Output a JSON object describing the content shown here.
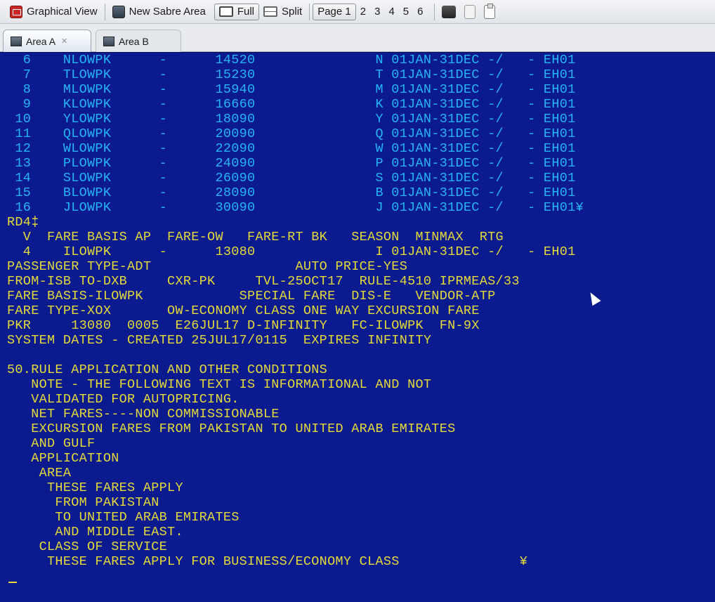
{
  "toolbar": {
    "graphical_view": "Graphical View",
    "new_sabre_area": "New Sabre Area",
    "full": "Full",
    "split": "Split",
    "page_label": "Page 1",
    "pages": [
      "2",
      "3",
      "4",
      "5",
      "6"
    ]
  },
  "tabs": [
    {
      "label": "Area A",
      "active": true
    },
    {
      "label": "Area B",
      "active": false
    }
  ],
  "terminal": {
    "background_color": "#0b1a8f",
    "text_color": "#e4da3a",
    "fare_row_color": "#25b5f2",
    "lines": [
      {
        "text": "  6    NLOWPK      -      14520               N 01JAN-31DEC -/   - EH01",
        "style": "cyan"
      },
      {
        "text": "  7    TLOWPK      -      15230               T 01JAN-31DEC -/   - EH01",
        "style": "cyan"
      },
      {
        "text": "  8    MLOWPK      -      15940               M 01JAN-31DEC -/   - EH01",
        "style": "cyan"
      },
      {
        "text": "  9    KLOWPK      -      16660               K 01JAN-31DEC -/   - EH01",
        "style": "cyan"
      },
      {
        "text": " 10    YLOWPK      -      18090               Y 01JAN-31DEC -/   - EH01",
        "style": "cyan"
      },
      {
        "text": " 11    QLOWPK      -      20090               Q 01JAN-31DEC -/   - EH01",
        "style": "cyan"
      },
      {
        "text": " 12    WLOWPK      -      22090               W 01JAN-31DEC -/   - EH01",
        "style": "cyan"
      },
      {
        "text": " 13    PLOWPK      -      24090               P 01JAN-31DEC -/   - EH01",
        "style": "cyan"
      },
      {
        "text": " 14    SLOWPK      -      26090               S 01JAN-31DEC -/   - EH01",
        "style": "cyan"
      },
      {
        "text": " 15    BLOWPK      -      28090               B 01JAN-31DEC -/   - EH01",
        "style": "cyan"
      },
      {
        "text": " 16    JLOWPK      -      30090               J 01JAN-31DEC -/   - EH01¥",
        "style": "cyan"
      },
      {
        "text": "RD4‡",
        "style": "normal"
      },
      {
        "text": "  V  FARE BASIS AP  FARE-OW   FARE-RT BK   SEASON  MINMAX  RTG",
        "style": "normal"
      },
      {
        "text": "  4    ILOWPK      -      13080               I 01JAN-31DEC -/   - EH01",
        "style": "normal"
      },
      {
        "text": "PASSENGER TYPE-ADT                  AUTO PRICE-YES",
        "style": "normal"
      },
      {
        "text": "FROM-ISB TO-DXB     CXR-PK     TVL-25OCT17  RULE-4510 IPRMEAS/33",
        "style": "normal"
      },
      {
        "text": "FARE BASIS-ILOWPK            SPECIAL FARE  DIS-E   VENDOR-ATP",
        "style": "normal"
      },
      {
        "text": "FARE TYPE-XOX       OW-ECONOMY CLASS ONE WAY EXCURSION FARE",
        "style": "normal"
      },
      {
        "text": "PKR     13080  0005  E26JUL17 D-INFINITY   FC-ILOWPK  FN-9X",
        "style": "normal"
      },
      {
        "text": "SYSTEM DATES - CREATED 25JUL17/0115  EXPIRES INFINITY",
        "style": "normal"
      },
      {
        "text": "",
        "style": "normal"
      },
      {
        "text": "50.RULE APPLICATION AND OTHER CONDITIONS",
        "style": "normal"
      },
      {
        "text": "   NOTE - THE FOLLOWING TEXT IS INFORMATIONAL AND NOT",
        "style": "normal"
      },
      {
        "text": "   VALIDATED FOR AUTOPRICING.",
        "style": "normal"
      },
      {
        "text": "   NET FARES----NON COMMISSIONABLE",
        "style": "normal"
      },
      {
        "text": "   EXCURSION FARES FROM PAKISTAN TO UNITED ARAB EMIRATES",
        "style": "normal"
      },
      {
        "text": "   AND GULF",
        "style": "normal"
      },
      {
        "text": "   APPLICATION",
        "style": "normal"
      },
      {
        "text": "    AREA",
        "style": "normal"
      },
      {
        "text": "     THESE FARES APPLY",
        "style": "normal"
      },
      {
        "text": "      FROM PAKISTAN",
        "style": "normal"
      },
      {
        "text": "      TO UNITED ARAB EMIRATES",
        "style": "normal"
      },
      {
        "text": "      AND MIDDLE EAST.",
        "style": "normal"
      },
      {
        "text": "    CLASS OF SERVICE",
        "style": "normal"
      },
      {
        "text": "     THESE FARES APPLY FOR BUSINESS/ECONOMY CLASS               ¥",
        "style": "normal"
      }
    ]
  }
}
